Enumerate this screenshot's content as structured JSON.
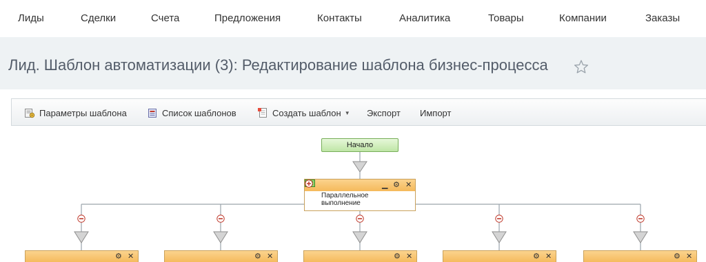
{
  "nav": {
    "items": [
      "Лиды",
      "Сделки",
      "Счета",
      "Предложения",
      "Контакты",
      "Аналитика",
      "Товары",
      "Компании",
      "Заказы"
    ]
  },
  "page": {
    "title": "Лид. Шаблон автоматизации (3): Редактирование шаблона бизнес-процесса"
  },
  "toolbar": {
    "params_label": "Параметры шаблона",
    "list_label": "Список шаблонов",
    "create_label": "Создать шаблон",
    "export_label": "Экспорт",
    "import_label": "Импорт"
  },
  "diagram": {
    "start_label": "Начало",
    "parallel_label_line1": "Параллельное",
    "parallel_label_line2": "выполнение",
    "branch_count": 5
  },
  "colors": {
    "nav_background": "#ffffff",
    "title_background": "#eef2f4",
    "block_header": "#f5b95b",
    "start_node": "#bfe6a6",
    "connector": "#9aa3ab"
  }
}
